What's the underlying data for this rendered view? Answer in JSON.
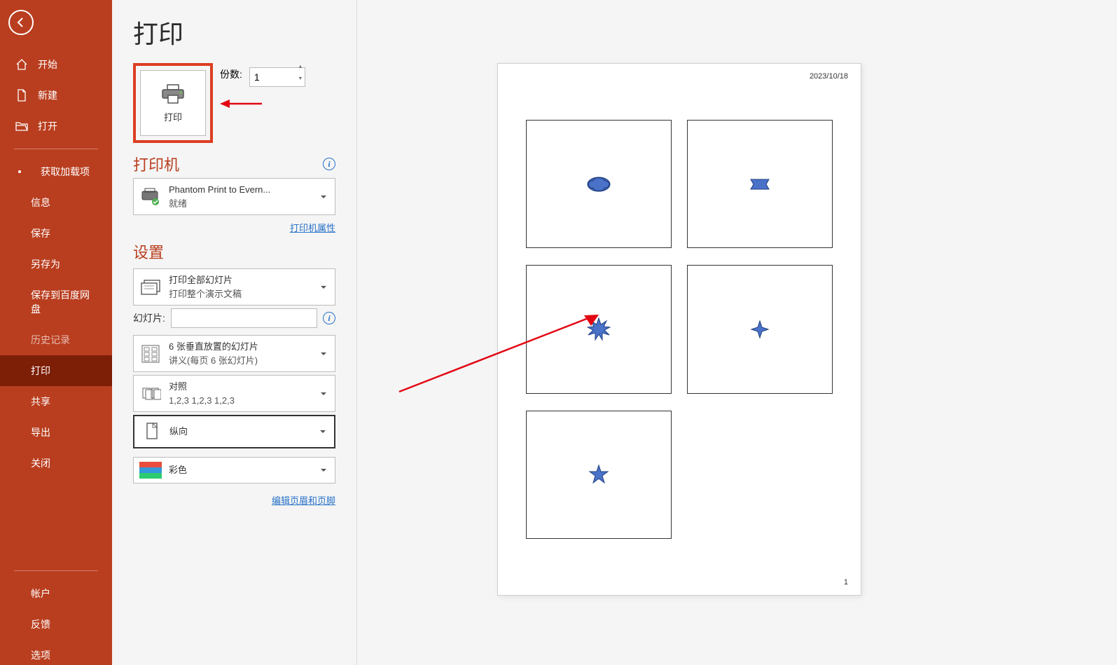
{
  "pageTitle": "打印",
  "sidebar": {
    "items": [
      {
        "label": "开始"
      },
      {
        "label": "新建"
      },
      {
        "label": "打开"
      },
      {
        "label": "获取加载项"
      },
      {
        "label": "信息"
      },
      {
        "label": "保存"
      },
      {
        "label": "另存为"
      },
      {
        "label": "保存到百度网盘"
      },
      {
        "label": "历史记录"
      },
      {
        "label": "打印"
      },
      {
        "label": "共享"
      },
      {
        "label": "导出"
      },
      {
        "label": "关闭"
      },
      {
        "label": "帐户"
      },
      {
        "label": "反馈"
      },
      {
        "label": "选项"
      }
    ]
  },
  "print": {
    "buttonLabel": "打印",
    "copiesLabel": "份数:",
    "copiesValue": "1"
  },
  "printer": {
    "sectionTitle": "打印机",
    "name": "Phantom Print to Evern...",
    "status": "就绪",
    "propertiesLink": "打印机属性"
  },
  "settings": {
    "sectionTitle": "设置",
    "printRange": {
      "line1": "打印全部幻灯片",
      "line2": "打印整个演示文稿"
    },
    "slidesLabel": "幻灯片:",
    "layout": {
      "line1": "6 张垂直放置的幻灯片",
      "line2": "讲义(每页 6 张幻灯片)"
    },
    "collate": {
      "line1": "对照",
      "line2": "1,2,3   1,2,3   1,2,3"
    },
    "orientation": "纵向",
    "color": "彩色",
    "editHeaderFooterLink": "编辑页眉和页脚"
  },
  "preview": {
    "date": "2023/10/18",
    "pageNumber": "1"
  }
}
